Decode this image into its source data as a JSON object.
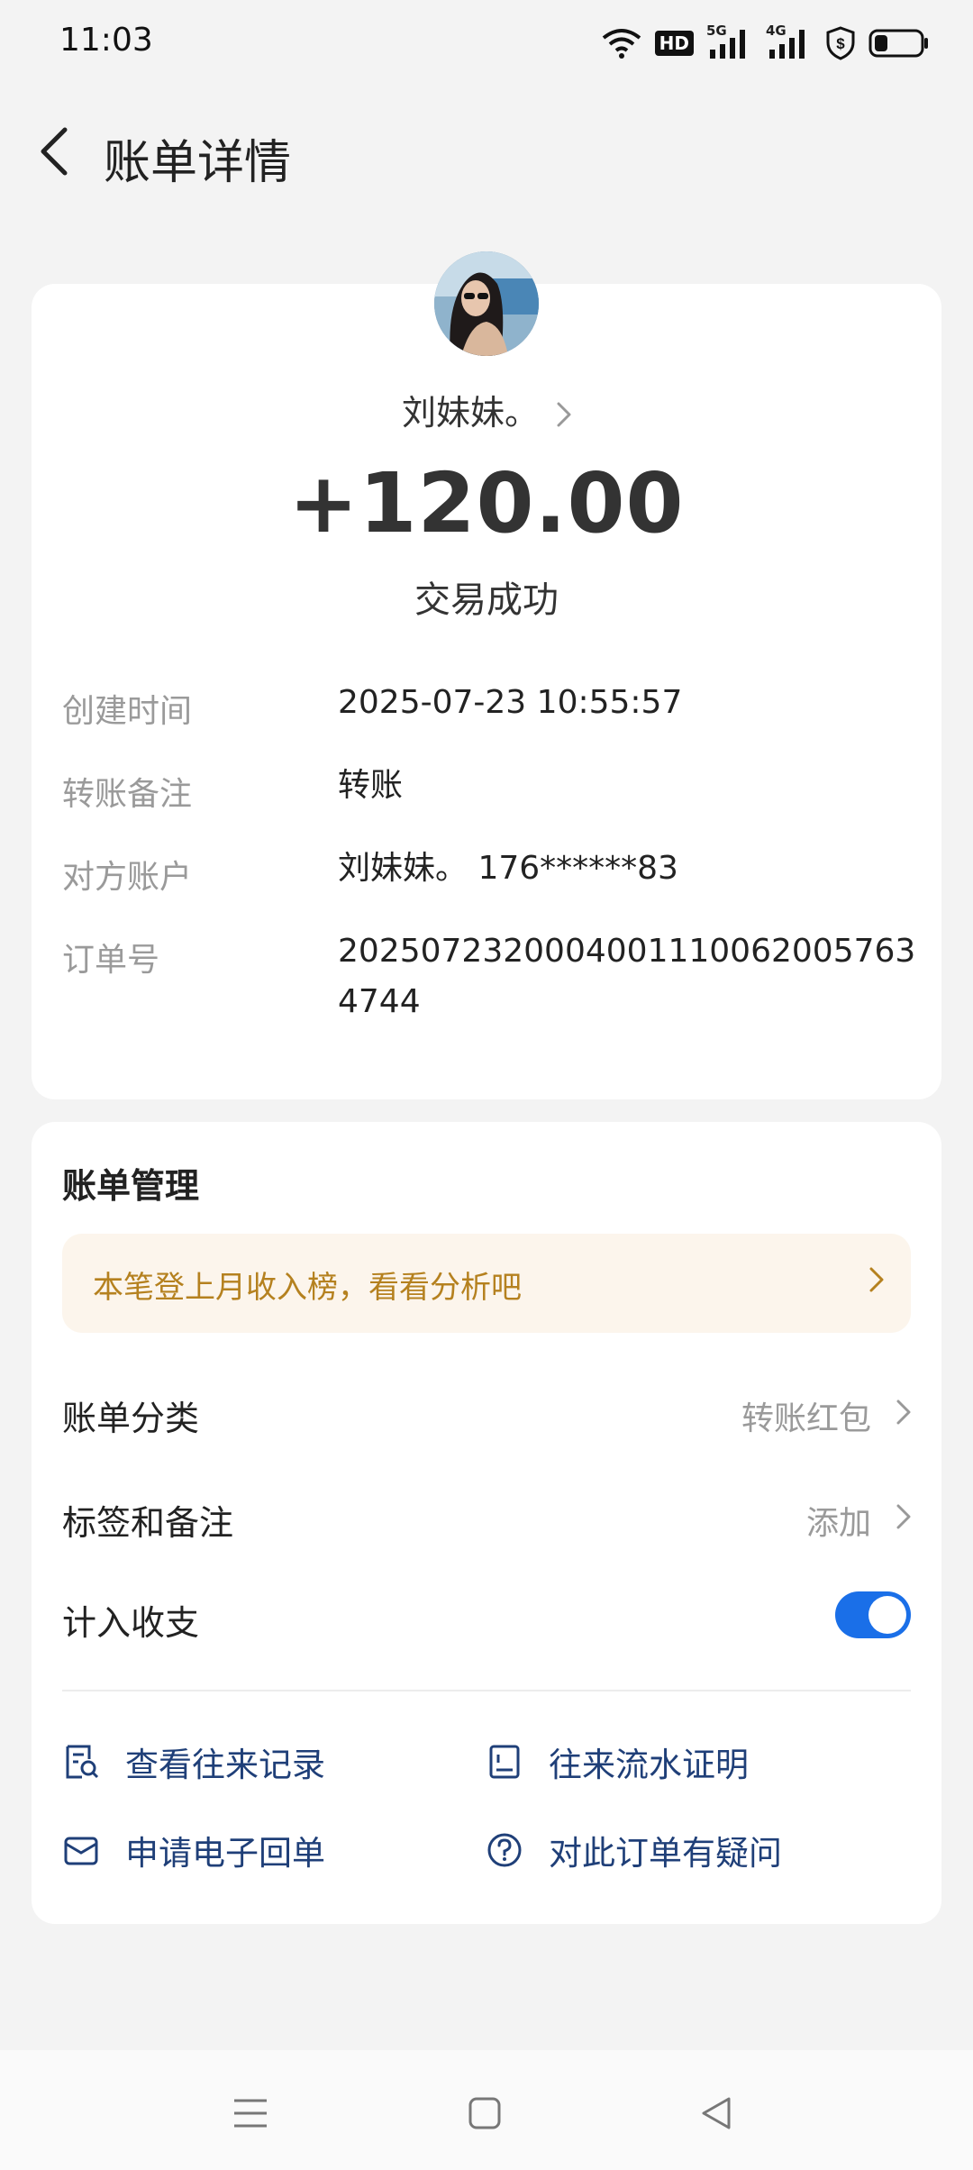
{
  "status_bar": {
    "time": "11:03",
    "icons": [
      "wifi-icon",
      "hd-icon",
      "signal-5g-icon",
      "signal-4g-icon",
      "vpn-shield-icon",
      "battery-icon"
    ],
    "hd_label": "HD",
    "network_5g": "5G",
    "network_4g": "4G"
  },
  "header": {
    "title": "账单详情"
  },
  "transaction": {
    "payee": "刘妹妹。",
    "amount": "+120.00",
    "status": "交易成功",
    "details": [
      {
        "label": "创建时间",
        "value": "2025-07-23 10:55:57"
      },
      {
        "label": "转账备注",
        "value": "转账"
      },
      {
        "label": "对方账户",
        "value": "刘妹妹。 176******83"
      },
      {
        "label": "订单号",
        "value": "20250723200040011100620057634744"
      }
    ]
  },
  "bill_management": {
    "title": "账单管理",
    "promo": "本笔登上月收入榜，看看分析吧",
    "category_label": "账单分类",
    "category_value": "转账红包",
    "tags_label": "标签和备注",
    "tags_value": "添加",
    "include_label": "计入收支",
    "include_enabled": true,
    "links": {
      "history": "查看往来记录",
      "proof": "往来流水证明",
      "receipt": "申请电子回单",
      "question": "对此订单有疑问"
    }
  },
  "colors": {
    "accent": "#1a6fe8",
    "link": "#1f3f78",
    "promo_text": "#b5811f",
    "promo_bg": "#fcf5ec"
  }
}
